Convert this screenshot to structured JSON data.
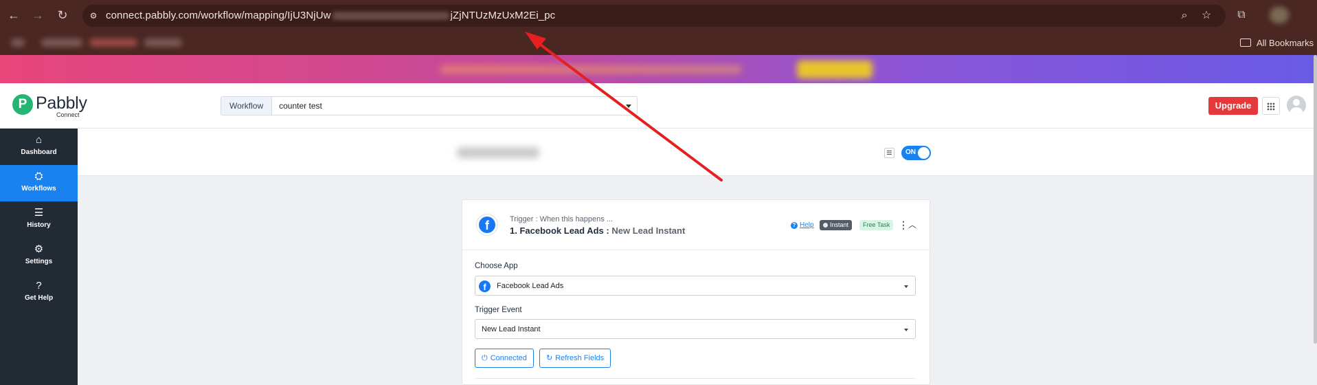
{
  "browser": {
    "url_start": "connect.pabbly.com/workflow/mapping/IjU3NjUw",
    "url_end": "jZjNTUzMzUxM2Ei_pc",
    "bookmarks_label": "All Bookmarks"
  },
  "app": {
    "logo_name": "Pabbly",
    "logo_sub": "Connect",
    "workflow_label": "Workflow",
    "workflow_name": "counter test",
    "upgrade_label": "Upgrade"
  },
  "sidebar": {
    "items": [
      {
        "label": "Dashboard",
        "icon": "home-icon"
      },
      {
        "label": "Workflows",
        "icon": "workflow-icon"
      },
      {
        "label": "History",
        "icon": "history-icon"
      },
      {
        "label": "Settings",
        "icon": "gear-icon"
      },
      {
        "label": "Get Help",
        "icon": "help-icon"
      }
    ]
  },
  "subheader": {
    "toggle_label": "ON"
  },
  "trigger": {
    "step_label": "Trigger : When this happens ...",
    "app_title": "1. Facebook Lead Ads :",
    "event_title": "New Lead Instant",
    "help_label": "Help",
    "instant_label": "Instant",
    "free_task_label": "Free Task",
    "choose_app_label": "Choose App",
    "choose_app_value": "Facebook Lead Ads",
    "trigger_event_label": "Trigger Event",
    "trigger_event_value": "New Lead Instant",
    "connected_label": "Connected",
    "refresh_label": "Refresh Fields"
  },
  "colors": {
    "primary": "#1a82f0",
    "upgrade": "#e5383b",
    "sidebar_bg": "#222a33",
    "annotation_arrow": "#e52020"
  }
}
